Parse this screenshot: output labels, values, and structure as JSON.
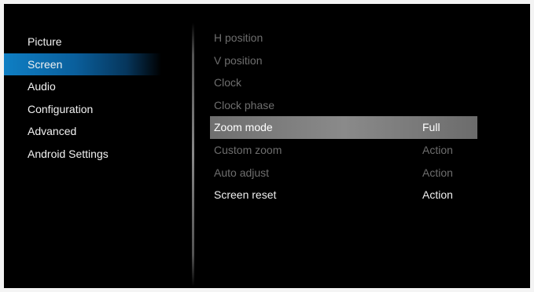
{
  "left_menu": {
    "items": [
      {
        "label": "Picture"
      },
      {
        "label": "Screen"
      },
      {
        "label": "Audio"
      },
      {
        "label": "Configuration"
      },
      {
        "label": "Advanced"
      },
      {
        "label": "Android Settings"
      }
    ],
    "selected": "Screen"
  },
  "right_menu": {
    "items": [
      {
        "label": "H position",
        "value": ""
      },
      {
        "label": "V position",
        "value": ""
      },
      {
        "label": "Clock",
        "value": ""
      },
      {
        "label": "Clock phase",
        "value": ""
      },
      {
        "label": "Zoom mode",
        "value": "Full"
      },
      {
        "label": "Custom zoom",
        "value": "Action"
      },
      {
        "label": "Auto adjust",
        "value": "Action"
      },
      {
        "label": "Screen reset",
        "value": "Action"
      }
    ],
    "selected": "Zoom mode"
  },
  "colors": {
    "background": "#000000",
    "selection_blue": "#0f7fc4",
    "selection_gray": "#8a8a8a",
    "enabled_text": "#f0f0f0",
    "disabled_text": "#6e6e6e"
  }
}
